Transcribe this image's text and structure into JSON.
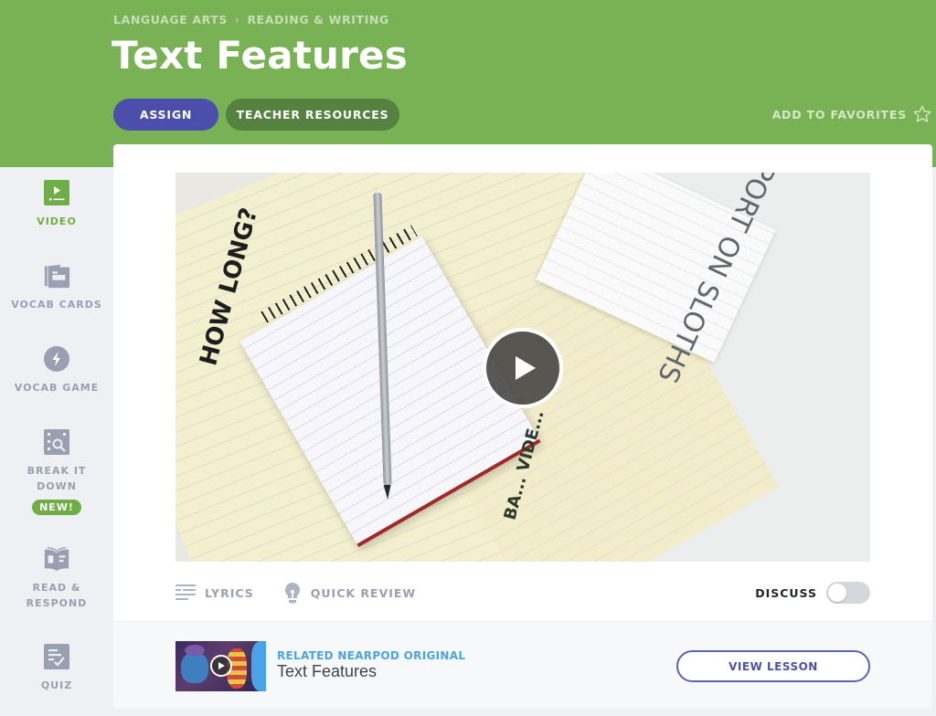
{
  "breadcrumb": {
    "items": [
      "LANGUAGE ARTS",
      "READING & WRITING"
    ],
    "separator": "›"
  },
  "header": {
    "title": "Text Features",
    "assign_label": "ASSIGN",
    "resources_label": "TEACHER RESOURCES",
    "favorites_label": "ADD TO FAVORITES"
  },
  "sidebar": {
    "items": [
      {
        "label": "VIDEO",
        "icon": "video-icon",
        "active": true
      },
      {
        "label": "VOCAB CARDS",
        "icon": "vocab-cards-icon"
      },
      {
        "label": "VOCAB GAME",
        "icon": "lightning-icon"
      },
      {
        "label": "BREAK IT DOWN",
        "icon": "magnifier-icon",
        "badge": "NEW!"
      },
      {
        "label": "READ & RESPOND",
        "icon": "book-icon"
      },
      {
        "label": "QUIZ",
        "icon": "quiz-icon"
      }
    ]
  },
  "video": {
    "bold_text_1": "HOW LONG?",
    "bold_text_2": "BA... VIDE...",
    "note_text": "A REPORT ON SLOTHS"
  },
  "toolbar": {
    "lyrics_label": "LYRICS",
    "quick_review_label": "QUICK REVIEW",
    "discuss_label": "DISCUSS",
    "discuss_on": false
  },
  "related": {
    "kicker": "RELATED NEARPOD ORIGINAL",
    "title": "Text Features",
    "button_label": "VIEW LESSON"
  },
  "colors": {
    "header_green": "#79b155",
    "assign_purple": "#4b4fab",
    "resources_green": "#568241",
    "active_green": "#6fae47",
    "related_blue": "#4aa3e8"
  }
}
